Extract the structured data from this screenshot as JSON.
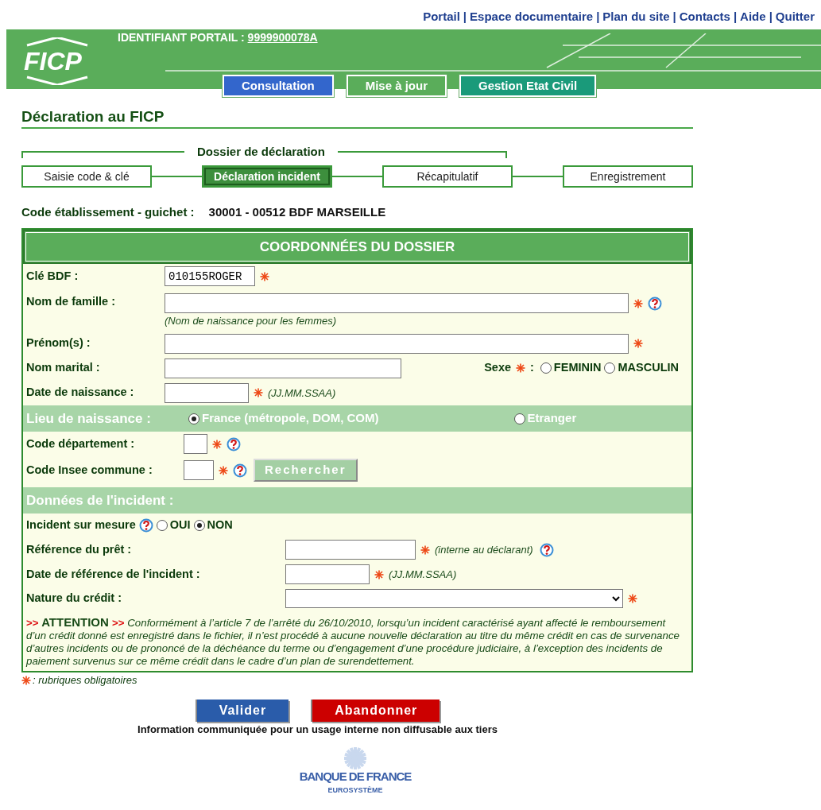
{
  "top_links": {
    "separator": "|",
    "items": [
      "Portail",
      "Espace documentaire",
      "Plan du site",
      "Contacts",
      "Aide",
      "Quitter"
    ]
  },
  "header": {
    "logo": "FICP",
    "identifiant_label": "IDENTIFIANT PORTAIL :",
    "identifiant_value": "9999900078A"
  },
  "nav_tabs": [
    {
      "label": "Consultation",
      "color": "#3366cc"
    },
    {
      "label": "Mise à jour",
      "color": "#5aad5a"
    },
    {
      "label": "Gestion Etat Civil",
      "color": "#1a9a7a"
    }
  ],
  "page_title": "Déclaration au FICP",
  "steps": {
    "group_label": "Dossier de déclaration",
    "items": [
      {
        "label": "Saisie code & clé",
        "selected": false
      },
      {
        "label": "Déclaration incident",
        "selected": true
      },
      {
        "label": "Récapitulatif",
        "selected": false
      },
      {
        "label": "Enregistrement",
        "selected": false
      }
    ]
  },
  "establishment": {
    "label": "Code établissement - guichet :",
    "value": "30001 - 00512  BDF MARSEILLE"
  },
  "dossier": {
    "title": "COORDONNÉES DU DOSSIER",
    "cle_bdf": {
      "label": "Clé BDF :",
      "value": "010155ROGER",
      "required": true
    },
    "nom_famille": {
      "label": "Nom de famille :",
      "required": true,
      "help": true,
      "note": "(Nom de naissance pour les femmes)"
    },
    "prenoms": {
      "label": "Prénom(s) :",
      "required": true
    },
    "nom_marital": {
      "label": "Nom marital :"
    },
    "sexe": {
      "label": "Sexe",
      "required": true,
      "colon": ":",
      "options": [
        {
          "label": "FEMININ",
          "selected": false
        },
        {
          "label": "MASCULIN",
          "selected": false
        }
      ]
    },
    "date_naissance": {
      "label": "Date de naissance :",
      "required": true,
      "note": "(JJ.MM.SSAA)"
    },
    "lieu_naissance": {
      "title": "Lieu de naissance :",
      "options": [
        {
          "label": "France (métropole, DOM, COM)",
          "selected": true
        },
        {
          "label": "Etranger",
          "selected": false
        }
      ]
    },
    "code_departement": {
      "label": "Code département :",
      "required": true,
      "help": true
    },
    "code_insee": {
      "label": "Code Insee commune :",
      "required": true,
      "help": true,
      "button": "Rechercher"
    }
  },
  "incident": {
    "title": "Données de l'incident :",
    "sur_mesure": {
      "label": "Incident sur mesure",
      "help": true,
      "options": [
        {
          "label": "OUI",
          "selected": false
        },
        {
          "label": "NON",
          "selected": true
        }
      ]
    },
    "reference_pret": {
      "label": "Référence du prêt :",
      "required": true,
      "note": "(interne au déclarant)",
      "help": true
    },
    "date_reference": {
      "label": "Date de référence de l'incident :",
      "required": true,
      "note": "(JJ.MM.SSAA)"
    },
    "nature_credit": {
      "label": "Nature du crédit :",
      "required": true
    },
    "attention": {
      "marker": ">>",
      "title": "ATTENTION",
      "text": "Conformément à l’article 7 de l’arrêté du 26/10/2010, lorsqu’un incident caractérisé ayant affecté le remboursement d’un crédit donné est enregistré dans le fichier, il n’est procédé à aucune nouvelle déclaration au titre du même crédit en cas de survenance d’autres incidents ou de prononcé de la déchéance du terme ou d’engagement d’une procédure judiciaire, à l’exception des incidents de paiement survenus sur ce même crédit dans le cadre d’un plan de surendettement."
    }
  },
  "required_legend": ": rubriques obligatoires",
  "buttons": [
    {
      "label": "Valider",
      "color": "#2a5caa"
    },
    {
      "label": "Abandonner",
      "color": "#cc0000"
    }
  ],
  "footer_note": "Information communiquée pour un usage interne non diffusable aux tiers",
  "footer_logo": {
    "name": "BANQUE DE FRANCE",
    "sub": "EUROSYSTÈME"
  }
}
